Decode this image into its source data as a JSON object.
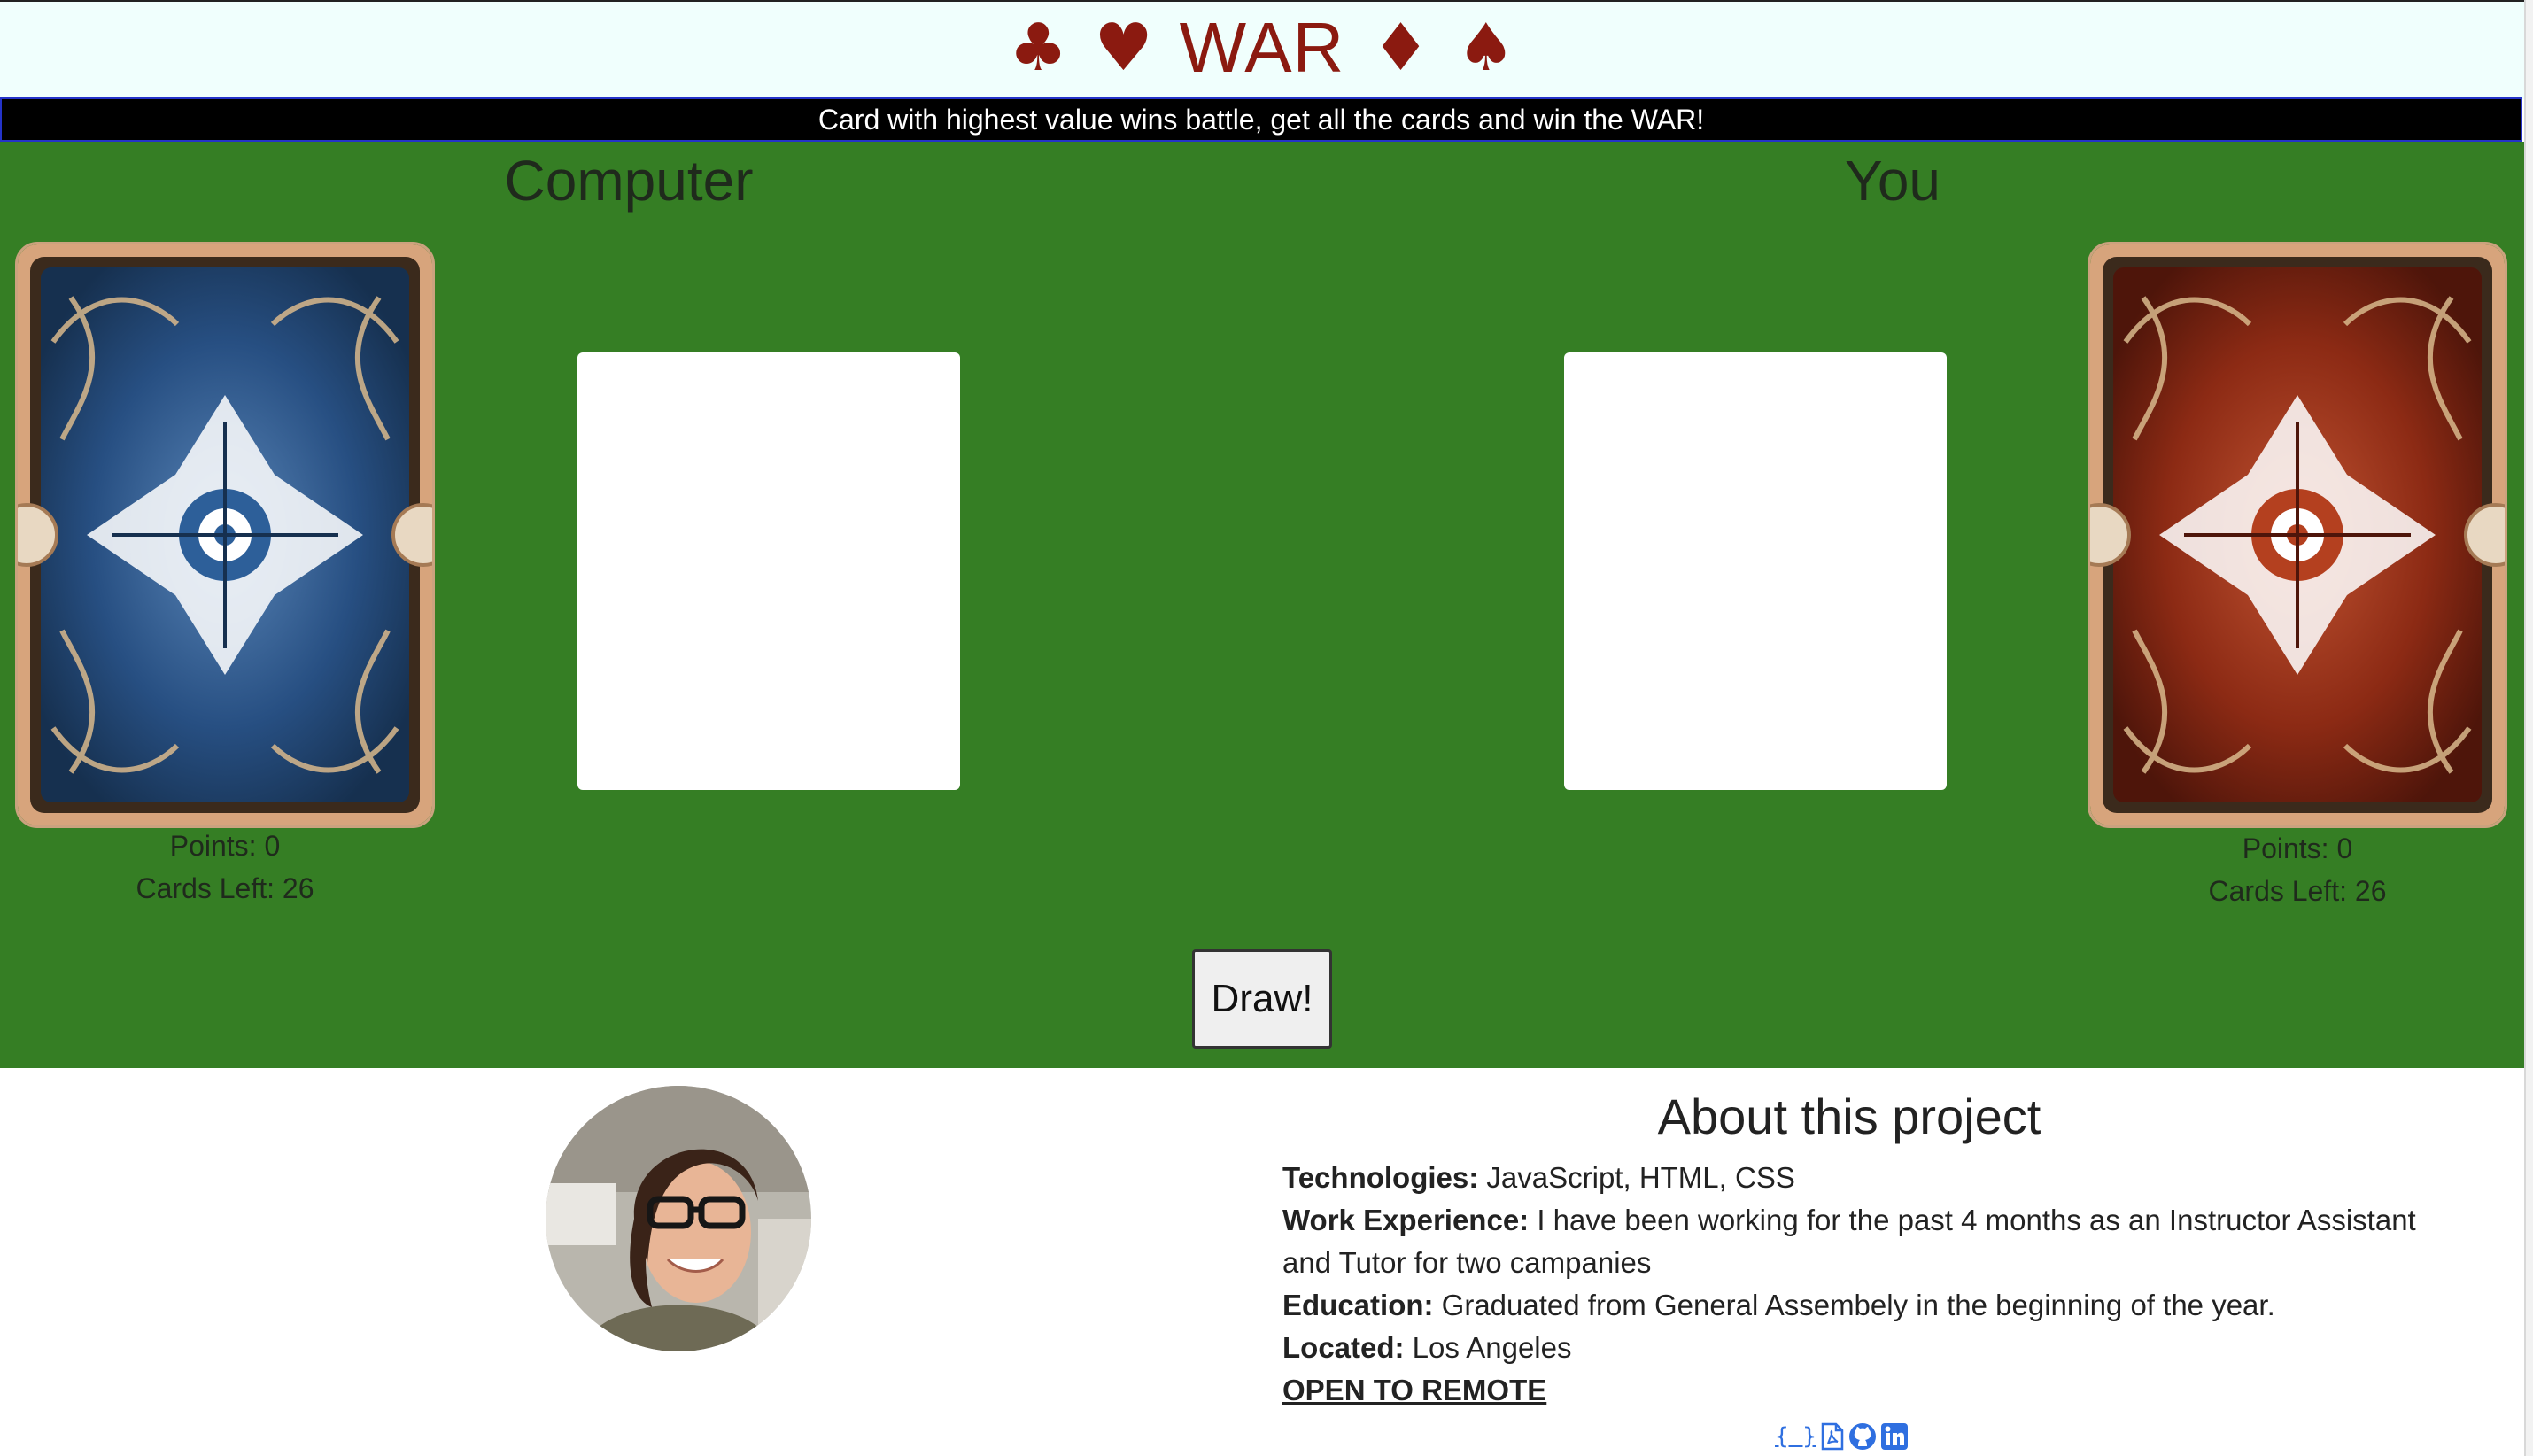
{
  "header": {
    "title": "WAR",
    "suits_left": [
      "♣",
      "♥"
    ],
    "suits_right": [
      "♦",
      "♠"
    ],
    "rule_text": "Card with highest value wins battle, get all the cards and win the WAR!"
  },
  "game": {
    "computer": {
      "heading": "Computer",
      "points_label": "Points: 0",
      "cards_label": "Cards Left: 26",
      "deck_color": "blue"
    },
    "player": {
      "heading": "You",
      "points_label": "Points: 0",
      "cards_label": "Cards Left: 26",
      "deck_color": "red"
    },
    "draw_label": "Draw!"
  },
  "about": {
    "title": "About this project",
    "tech_label": "Technologies:",
    "tech_value": " JavaScript, HTML, CSS",
    "work_label": "Work Experience:",
    "work_value": " I have been working for the past 4 months as an Instructor Assistant and Tutor for two campanies",
    "edu_label": "Education:",
    "edu_value": " Graduated from General Assembely in the beginning of the year.",
    "loc_label": "Located:",
    "loc_value": " Los Angeles",
    "remote_link": "OPEN TO REMOTE",
    "code_icon_text": "{ }"
  },
  "links": [
    "code-icon",
    "pdf-icon",
    "github-icon",
    "linkedin-icon"
  ],
  "colors": {
    "header_bg": "#f0fffd",
    "title": "#8b1a10",
    "board": "#357e24",
    "rule_bar": "#000000",
    "link": "#2f6fe0"
  }
}
